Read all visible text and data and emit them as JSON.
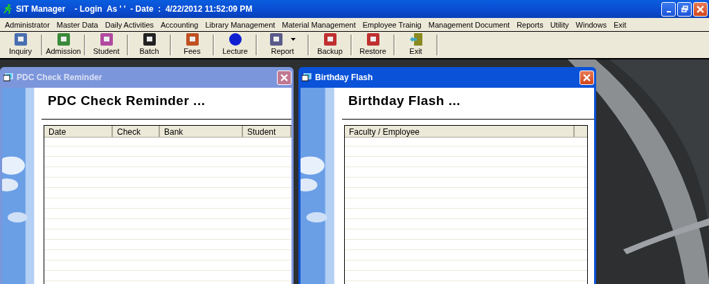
{
  "window": {
    "title": "SIT Manager    - Login  As ' '  - Date  :  4/22/2012 11:52:09 PM"
  },
  "menu": [
    "Administrator",
    "Master Data",
    "Daily Activities",
    "Accounting",
    "Library Management",
    "Material Management",
    "Employee Trainig",
    "Management Document",
    "Reports",
    "Utility",
    "Windows",
    "Exit"
  ],
  "toolbar": [
    {
      "label": "Inquiry",
      "kind": "inquiry",
      "dropdown": false
    },
    {
      "label": "Admission",
      "kind": "admission",
      "dropdown": false
    },
    {
      "label": "Student",
      "kind": "student",
      "dropdown": false
    },
    {
      "label": "Batch",
      "kind": "batch",
      "dropdown": false
    },
    {
      "label": "Fees",
      "kind": "fees",
      "dropdown": false
    },
    {
      "label": "Lecture",
      "kind": "lecture",
      "dropdown": false
    },
    {
      "label": "Report",
      "kind": "report",
      "dropdown": true
    },
    {
      "label": "Backup",
      "kind": "backup",
      "dropdown": false
    },
    {
      "label": "Restore",
      "kind": "restore",
      "dropdown": false
    },
    {
      "label": "Exit",
      "kind": "exit",
      "dropdown": false
    }
  ],
  "child_windows": [
    {
      "title": "PDC Check Reminder",
      "heading": "PDC Check Reminder ...",
      "active": false,
      "columns": [
        "Date",
        "Check",
        "Bank",
        "Student"
      ]
    },
    {
      "title": "Birthday Flash",
      "heading": "Birthday Flash ...",
      "active": true,
      "columns": [
        "Faculty / Employee"
      ]
    }
  ]
}
